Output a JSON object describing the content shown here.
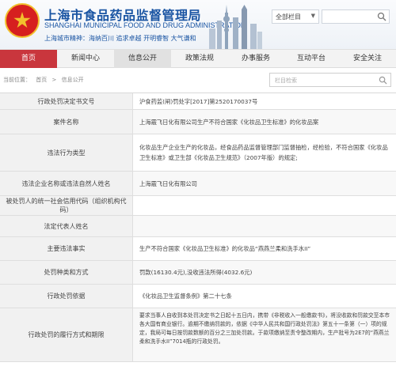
{
  "header": {
    "title_cn": "上海市食品药品监督管理局",
    "title_en": "SHANGHAI MUNICIPAL FOOD AND DRUG ADMINISTRATION",
    "slogan": "上海城市精神：海纳百川  追求卓越  开明睿智  大气谦和",
    "scope_select": "全部栏目"
  },
  "nav": {
    "items": [
      "首页",
      "新闻中心",
      "信息公开",
      "政策法规",
      "办事服务",
      "互动平台",
      "安全关注"
    ]
  },
  "breadcrumb": {
    "items": [
      "当前位置：",
      "首页",
      ">",
      "信息公开"
    ]
  },
  "site_search": {
    "placeholder": "栏目检索"
  },
  "table": {
    "rows": [
      {
        "label": "行政处罚决定书文号",
        "value": "沪食药监(闸)罚处字[2017]第2520170037号"
      },
      {
        "label": "案件名称",
        "value": "上海霰飞日化有限公司生产不符合国家《化妆品卫生标准》的化妆品案"
      },
      {
        "label": "违法行为类型",
        "value": "化妆品生产企业生产的化妆品，经食品药品监督管理部门监督抽检，经检验，不符合国家《化妆品卫生标准》或卫生部《化妆品卫生规范》（2007年版）的规定;"
      },
      {
        "label": "违法企业名称或违法自然人姓名",
        "value": "上海霰飞日化有限公司"
      },
      {
        "label": "被处罚人的统一社会信用代码（组织机构代码）",
        "value": ""
      },
      {
        "label": "法定代表人姓名",
        "value": ""
      },
      {
        "label": "主要违法事实",
        "value": "生产不符合国家《化妆品卫生标准》的化妆品“燕燕兰柔和洗手水II”"
      },
      {
        "label": "处罚种类和方式",
        "value": "罚款(16130.4元),没收违法所得(4032.6元)"
      },
      {
        "label": "行政处罚依据",
        "value": "《化妆品卫生监督条例》第二十七条"
      },
      {
        "label": "行政处罚的履行方式和期限",
        "value": "要求当事人自收到本处罚决定书之日起十五日内，携带《非税收入一般缴款书》，将没收款和罚款交至本市各大国有商业银行。逾期不缴纳罚款的，依据《中华人民共和国行政处罚法》第五十一条第（一）项的规定，我局可每日按罚款数额的百分之三加处罚款。于款项缴纳至责令整改期内，生产批号为2E7的“燕燕兰柔和洗手水II”7014瓶的行政处罚。"
      }
    ]
  }
}
